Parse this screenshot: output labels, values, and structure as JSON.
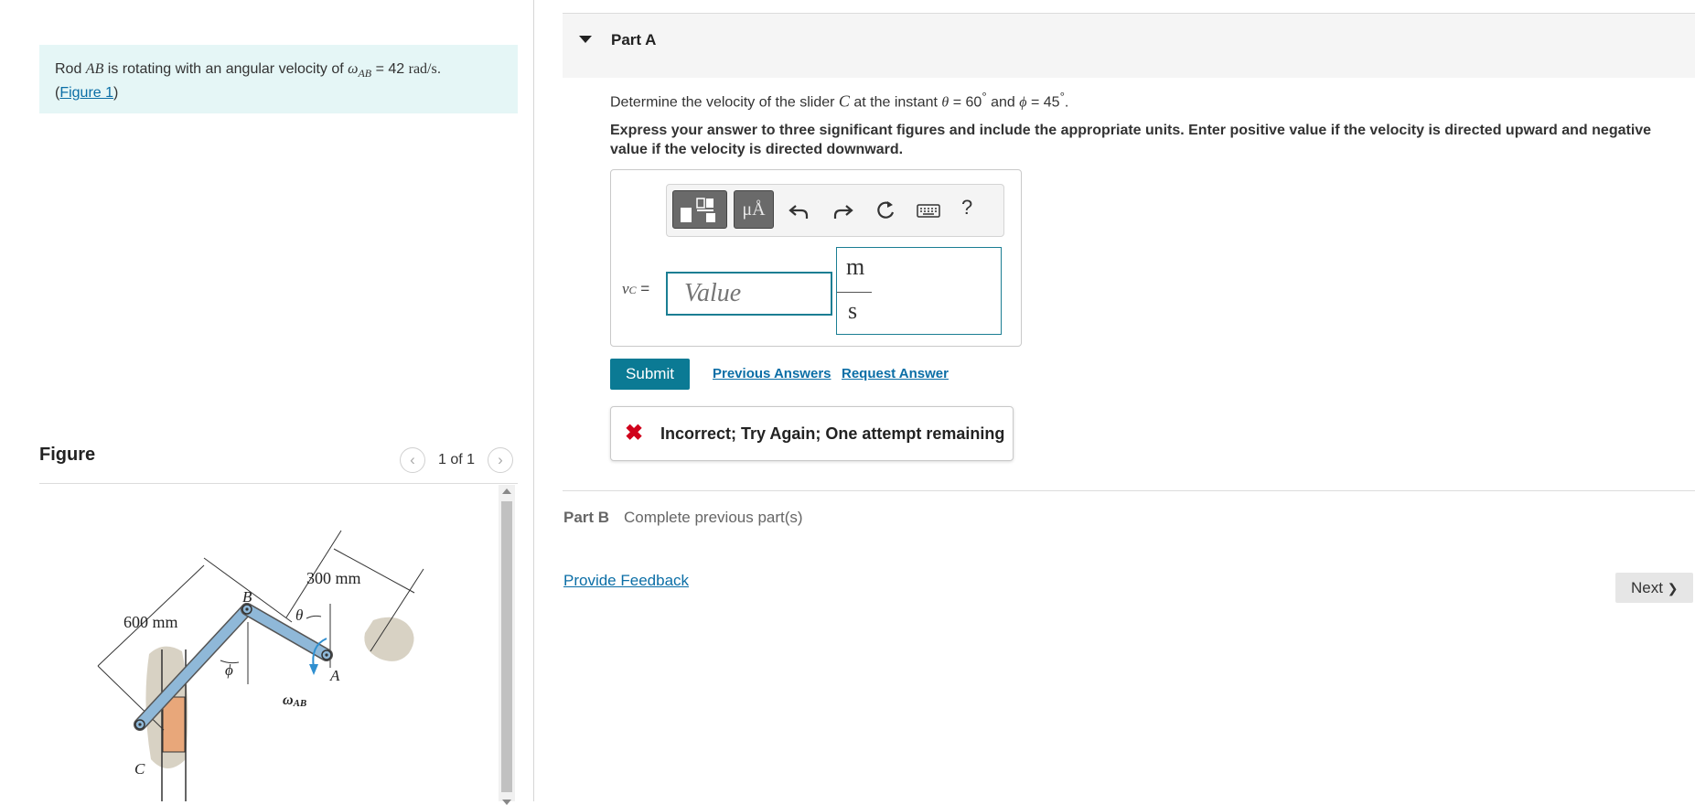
{
  "problem": {
    "text_prefix": "Rod ",
    "rod_name": "AB",
    "text_middle": " is rotating with an angular velocity of ",
    "omega_symbol": "ω",
    "omega_sub": "AB",
    "equals_value": " = 42 ",
    "omega_unit": "rad/s",
    "period": ".",
    "figure_link_open": "(",
    "figure_link": "Figure 1",
    "figure_link_close": ")"
  },
  "figure_panel": {
    "title": "Figure",
    "counter": "1 of 1",
    "prev_glyph": "‹",
    "next_glyph": "›",
    "labels": {
      "dim_600": "600 mm",
      "dim_300": "300 mm",
      "point_b": "B",
      "point_a": "A",
      "point_c": "C",
      "theta": "θ",
      "phi": "ϕ",
      "omega": "ω",
      "omega_sub": "AB"
    }
  },
  "part_a": {
    "title": "Part A",
    "question_prefix": "Determine the velocity of the slider ",
    "slider": "C",
    "question_middle": " at the instant ",
    "theta": "θ",
    "theta_value": " = 60",
    "degree": "°",
    "and": " and ",
    "phi": "ϕ",
    "phi_value": " = 45",
    "end": ".",
    "instructions": "Express your answer to three significant figures and include the appropriate units. Enter positive value if the velocity is directed upward and negative value if the velocity is directed downward.",
    "toolbar": {
      "units_label": "μÅ",
      "help_label": "?"
    },
    "variable": "v",
    "variable_sub": "C",
    "equals": " =",
    "value_placeholder": "Value",
    "unit_numerator": "m",
    "unit_denominator": "s",
    "submit_label": "Submit",
    "previous_answers_label": "Previous Answers",
    "request_answer_label": "Request Answer",
    "feedback_icon": "✖",
    "feedback_text": "Incorrect; Try Again; One attempt remaining"
  },
  "part_b": {
    "label": "Part B",
    "status": "Complete previous part(s)"
  },
  "footer": {
    "provide_feedback": "Provide Feedback",
    "next_label": "Next",
    "next_glyph": "❯"
  },
  "colors": {
    "accent": "#0b7a94",
    "link": "#0b6ea6",
    "problem_bg": "#e5f6f6",
    "error": "#d0021b",
    "rod": "#8fb8d8"
  }
}
